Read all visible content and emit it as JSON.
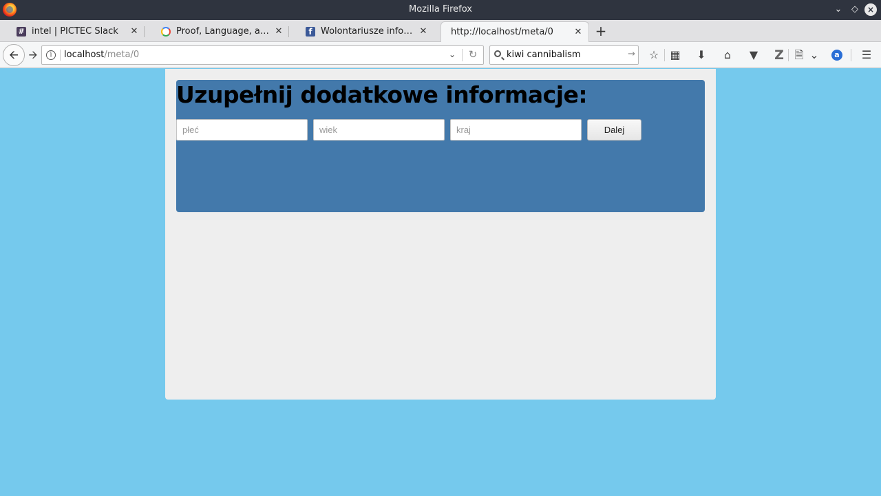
{
  "window": {
    "title": "Mozilla Firefox"
  },
  "tabs": [
    {
      "label": "intel | PICTEC Slack",
      "icon": "slack-icon"
    },
    {
      "label": "Proof, Language, and I...",
      "icon": "google-icon"
    },
    {
      "label": "Wolontariusze infoShar...",
      "icon": "facebook-icon"
    },
    {
      "label": "http://localhost/meta/0",
      "icon": ""
    }
  ],
  "navbar": {
    "url_host": "localhost",
    "url_path": "/meta/0",
    "search_value": "kiwi cannibalism"
  },
  "form": {
    "heading": "Uzupełnij dodatkowe informacje:",
    "sex_placeholder": "płeć",
    "age_placeholder": "wiek",
    "country_placeholder": "kraj",
    "submit_label": "Dalej"
  },
  "colors": {
    "page_background": "#75c9ed",
    "panel_background": "#eeeeee",
    "card_background": "#4379ab"
  }
}
